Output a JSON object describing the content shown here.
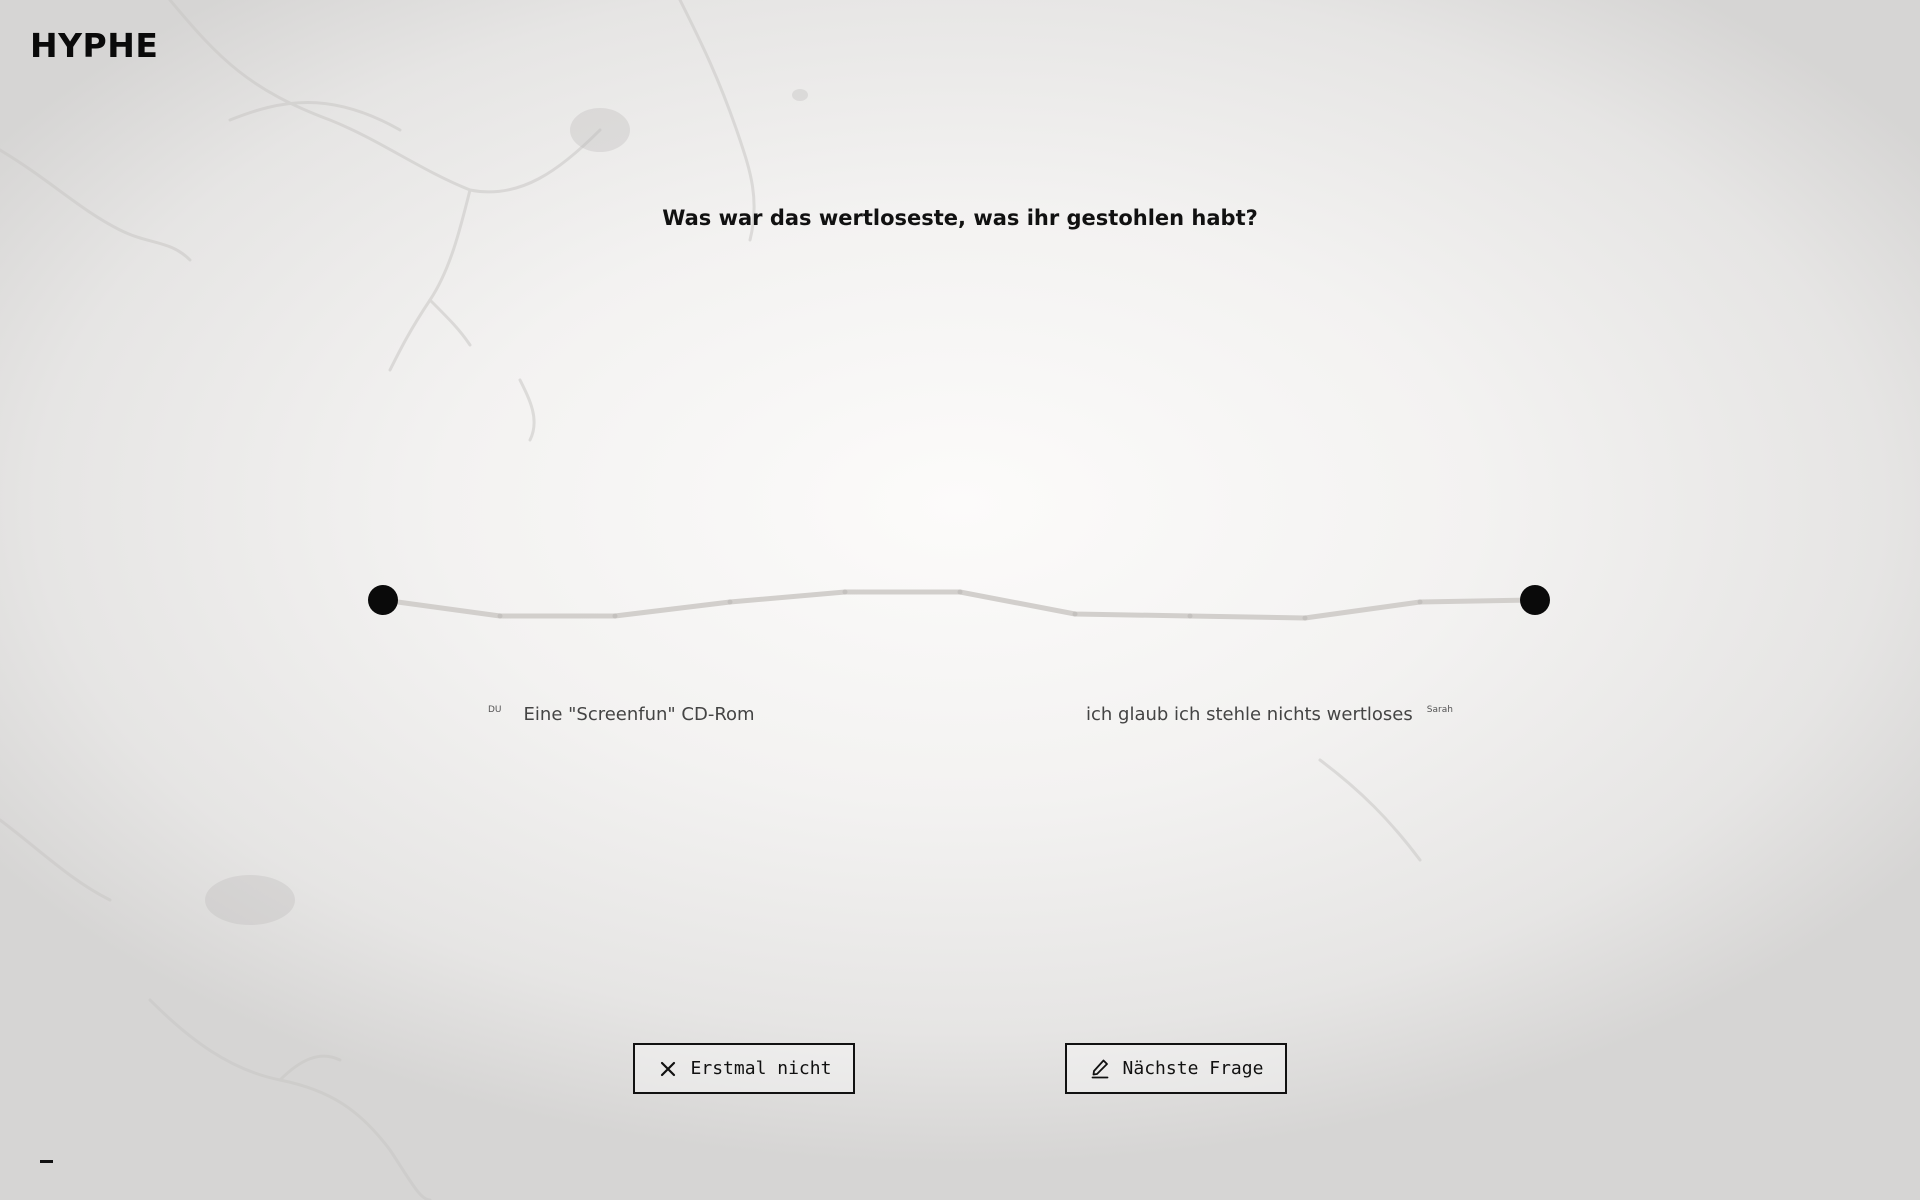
{
  "brand": {
    "logo": "HYPHE"
  },
  "question": {
    "text": "Was war das wertloseste, was ihr gestohlen habt?"
  },
  "answers": [
    {
      "author": "DU",
      "text": "Eine \"Screenfun\" CD-Rom"
    },
    {
      "author": "Sarah",
      "text": "ich glaub ich stehle nichts wertloses"
    }
  ],
  "actions": {
    "skip_label": "Erstmal nicht",
    "next_label": "Nächste Frage"
  },
  "icons": {
    "skip": "close-icon",
    "next": "pencil-icon",
    "menu": "menu-dash-icon"
  },
  "colors": {
    "ink": "#111111",
    "thread": "#d2cfcc",
    "background": "#f3f2f1"
  }
}
